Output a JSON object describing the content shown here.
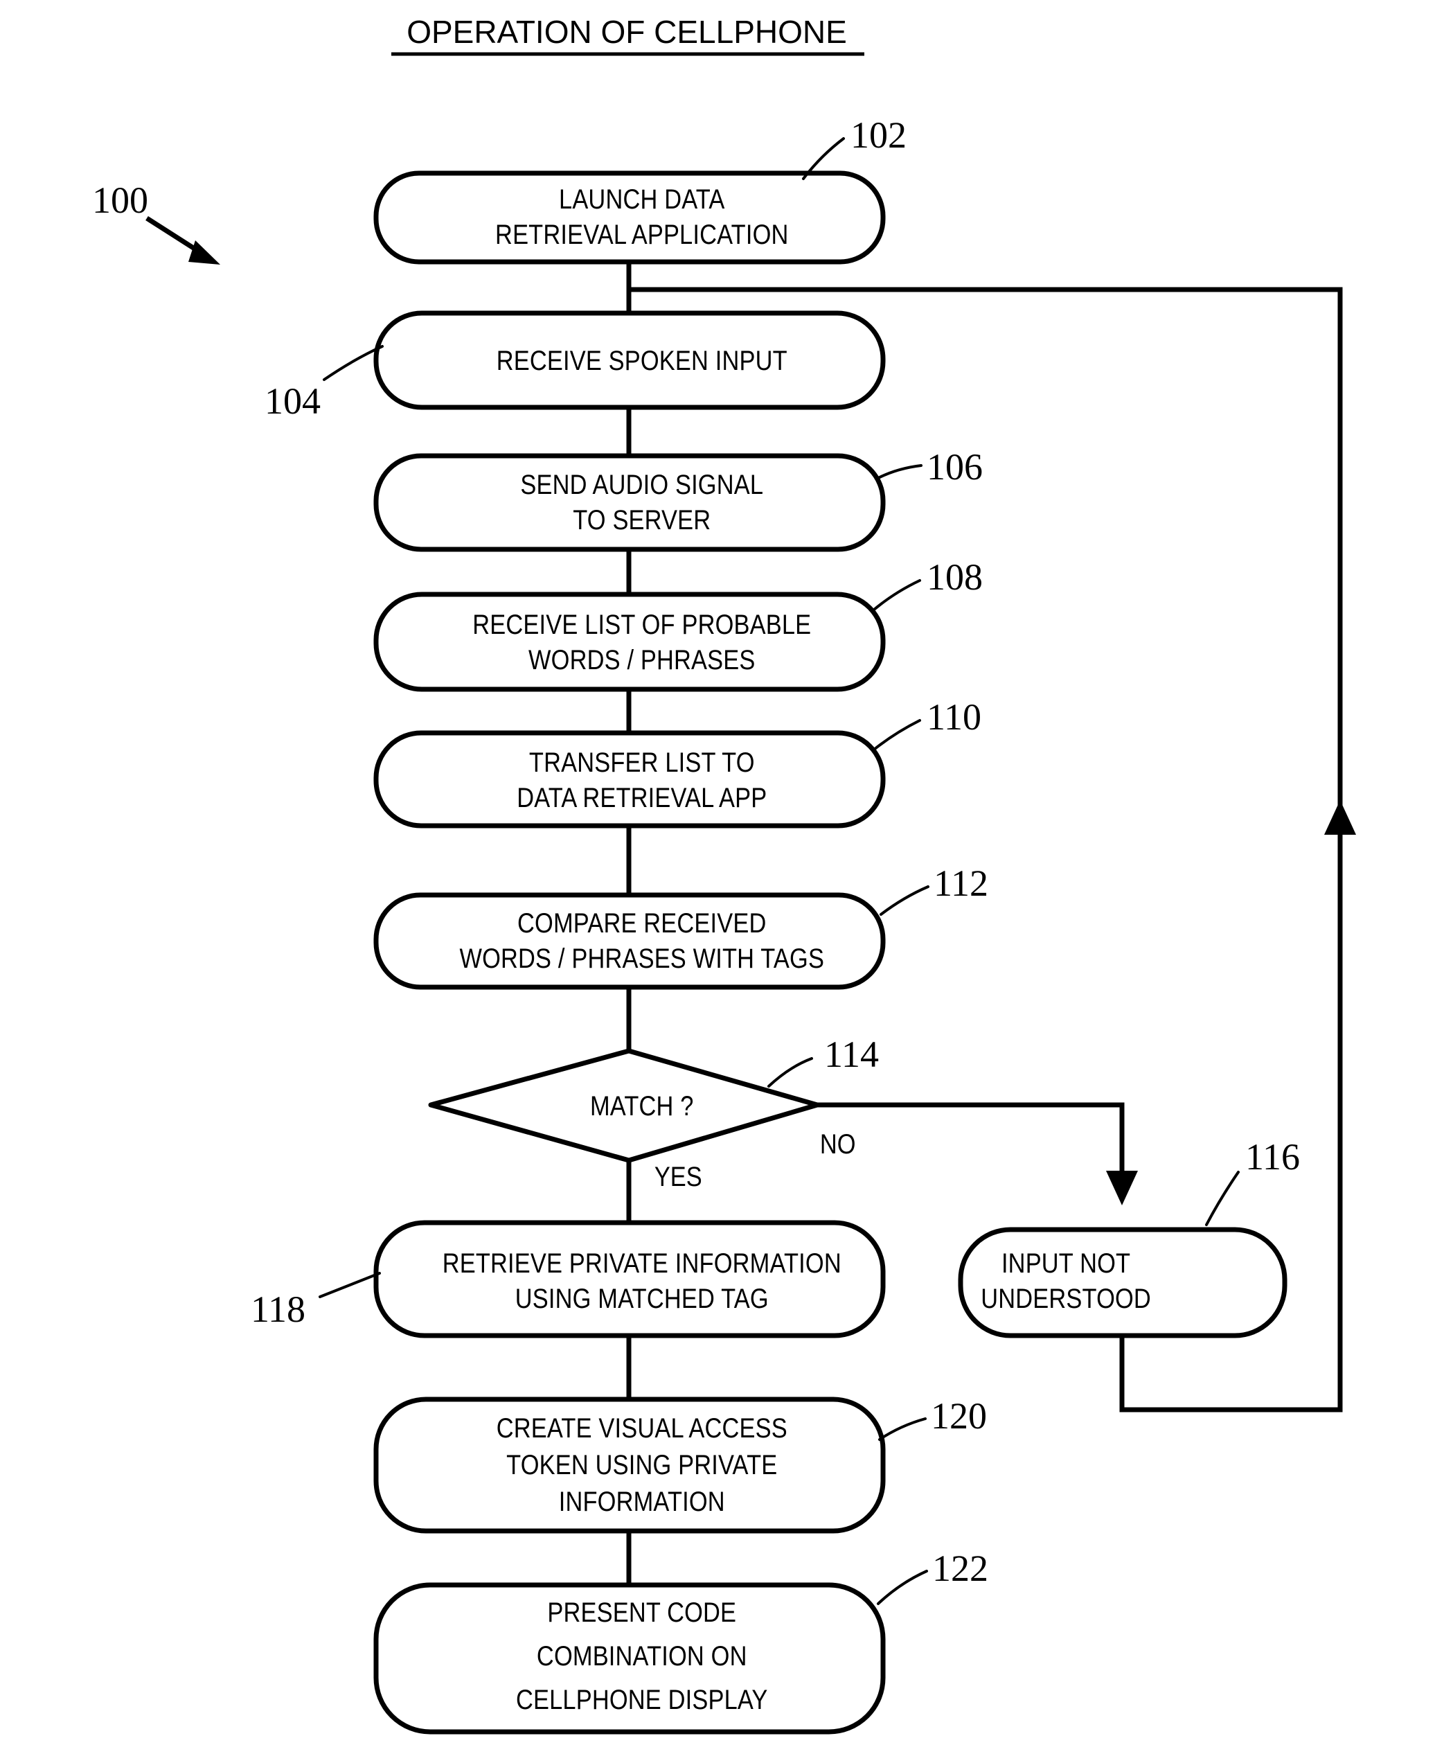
{
  "figure": {
    "title": "OPERATION OF CELLPHONE",
    "figure_ref": "100",
    "ink_color": "#000000",
    "background_color": "#ffffff"
  },
  "nodes": [
    {
      "id": "102",
      "ref": "102",
      "shape": "rounded-rectangle",
      "lines": [
        "LAUNCH DATA",
        "RETRIEVAL APPLICATION"
      ]
    },
    {
      "id": "104",
      "ref": "104",
      "shape": "rounded-rectangle",
      "lines": [
        "RECEIVE SPOKEN INPUT"
      ]
    },
    {
      "id": "106",
      "ref": "106",
      "shape": "rounded-rectangle",
      "lines": [
        "SEND AUDIO SIGNAL",
        "TO SERVER"
      ]
    },
    {
      "id": "108",
      "ref": "108",
      "shape": "rounded-rectangle",
      "lines": [
        "RECEIVE LIST OF PROBABLE",
        "WORDS / PHRASES"
      ]
    },
    {
      "id": "110",
      "ref": "110",
      "shape": "rounded-rectangle",
      "lines": [
        "TRANSFER LIST TO",
        "DATA RETRIEVAL APP"
      ]
    },
    {
      "id": "112",
      "ref": "112",
      "shape": "rounded-rectangle",
      "lines": [
        "COMPARE RECEIVED",
        "WORDS / PHRASES WITH TAGS"
      ]
    },
    {
      "id": "114",
      "ref": "114",
      "shape": "diamond",
      "lines": [
        "MATCH ?"
      ]
    },
    {
      "id": "116",
      "ref": "116",
      "shape": "rounded-rectangle",
      "lines": [
        "INPUT NOT",
        "UNDERSTOOD"
      ]
    },
    {
      "id": "118",
      "ref": "118",
      "shape": "rounded-rectangle",
      "lines": [
        "RETRIEVE PRIVATE INFORMATION",
        "USING MATCHED TAG"
      ]
    },
    {
      "id": "120",
      "ref": "120",
      "shape": "rounded-rectangle",
      "lines": [
        "CREATE VISUAL ACCESS",
        "TOKEN USING PRIVATE",
        "INFORMATION"
      ]
    },
    {
      "id": "122",
      "ref": "122",
      "shape": "rounded-rectangle",
      "lines": [
        "PRESENT CODE",
        "COMBINATION ON",
        "CELLPHONE DISPLAY"
      ]
    }
  ],
  "branch_labels": {
    "yes": "YES",
    "no": "NO"
  }
}
